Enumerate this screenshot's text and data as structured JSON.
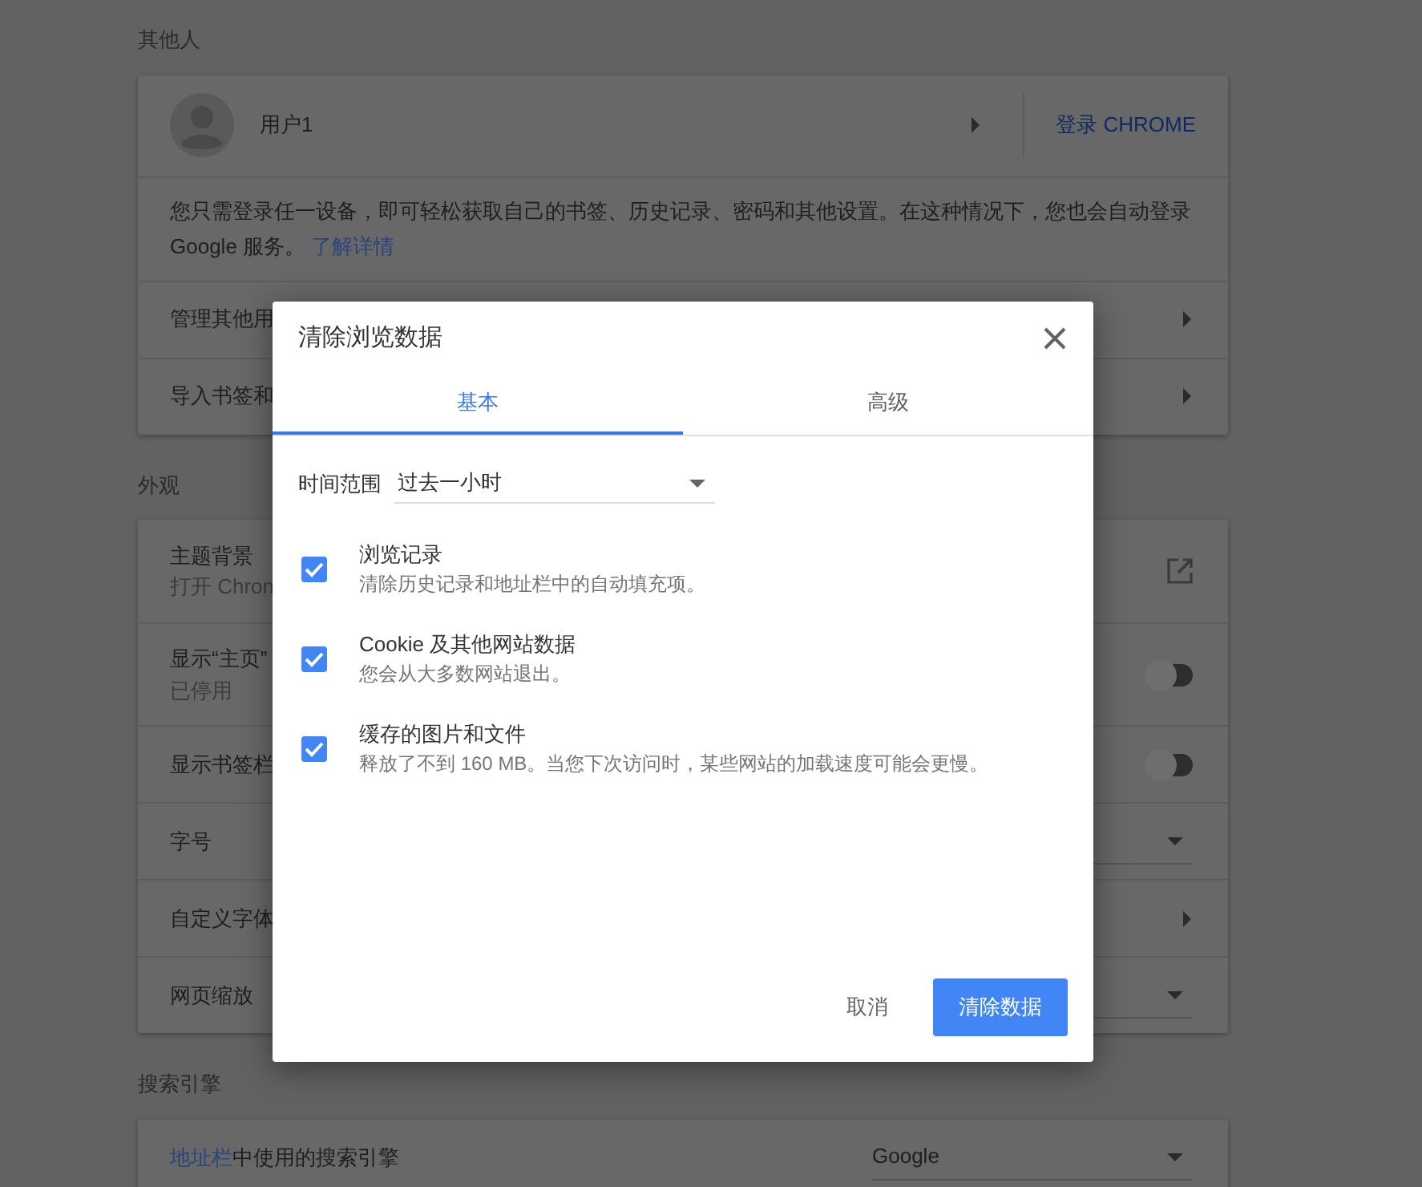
{
  "sections": [
    {
      "title": "其他人",
      "user": {
        "name": "用户1",
        "sign_in": "登录 CHROME"
      },
      "description": "您只需登录任一设备，即可轻松获取自己的书签、历史记录、密码和其他设置。在这种情况下，您也会自动登录 Google 服务。",
      "learn_more": "了解详情",
      "rows": [
        {
          "kind": "arrow",
          "label": "管理其他用"
        },
        {
          "kind": "arrow",
          "label": "导入书签和"
        }
      ]
    },
    {
      "title": "外观",
      "rows": [
        {
          "kind": "external",
          "label": "主题背景",
          "sublabel": "打开 Chron"
        },
        {
          "kind": "toggle",
          "label": "显示“主页”",
          "sublabel": "已停用",
          "on": false
        },
        {
          "kind": "toggle",
          "label": "显示书签栏",
          "on": false
        },
        {
          "kind": "dropdown",
          "label": "字号"
        },
        {
          "kind": "arrow",
          "label": "自定义字体"
        },
        {
          "kind": "dropdown",
          "label": "网页缩放"
        }
      ]
    },
    {
      "title": "搜索引擎",
      "rows": [
        {
          "kind": "dropdown",
          "label_link": "地址栏",
          "label": "中使用的搜索引擎",
          "value": "Google"
        }
      ]
    }
  ],
  "dialog": {
    "title": "清除浏览数据",
    "tabs": [
      {
        "label": "基本",
        "selected": true
      },
      {
        "label": "高级",
        "selected": false
      }
    ],
    "time_range": {
      "label": "时间范围",
      "value": "过去一小时"
    },
    "options": [
      {
        "label": "浏览记录",
        "detail": "清除历史记录和地址栏中的自动填充项。",
        "checked": true
      },
      {
        "label": "Cookie 及其他网站数据",
        "detail": "您会从大多数网站退出。",
        "checked": true
      },
      {
        "label": "缓存的图片和文件",
        "detail": "释放了不到 160 MB。当您下次访问时，某些网站的加载速度可能会更慢。",
        "checked": true
      }
    ],
    "cancel": "取消",
    "confirm": "清除数据"
  }
}
